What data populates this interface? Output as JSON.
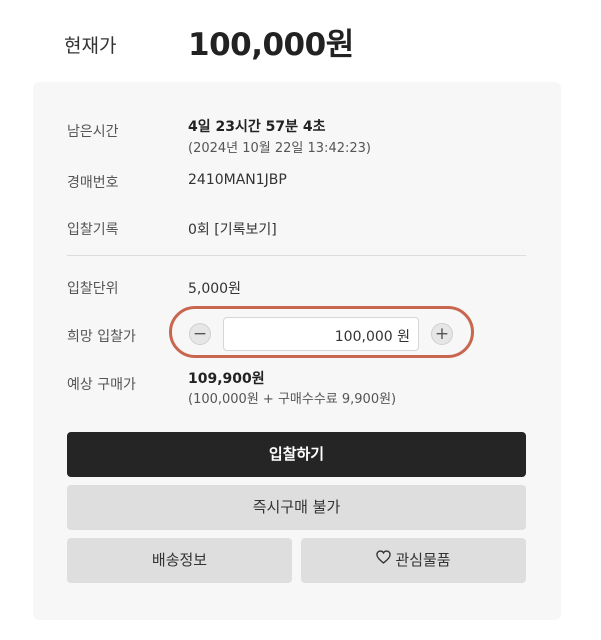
{
  "price": {
    "label": "현재가",
    "value": "100,000원"
  },
  "info": {
    "remaining_label": "남은시간",
    "remaining_value": "4일 23시간 57분 4초",
    "remaining_date": "(2024년 10월 22일 13:42:23)",
    "auction_no_label": "경매번호",
    "auction_no_value": "2410MAN1JBP",
    "bid_history_label": "입찰기록",
    "bid_history_count": "0회",
    "bid_history_link": "[기록보기]"
  },
  "bidding": {
    "unit_label": "입찰단위",
    "unit_value": "5,000원",
    "desired_label": "희망 입찰가",
    "decrement_symbol": "−",
    "increment_symbol": "+",
    "bid_amount": "100,000 원",
    "expected_label": "예상 구매가",
    "expected_value": "109,900원",
    "expected_breakdown": "(100,000원 + 구매수수료 9,900원)"
  },
  "actions": {
    "bid_button": "입찰하기",
    "instant_buy_button": "즉시구매 불가",
    "shipping_button": "배송정보",
    "wishlist_button": "관심물품",
    "wishlist_icon": "heart-outline-icon"
  },
  "colors": {
    "primary_button": "#252525",
    "highlight_outline": "#c9664f",
    "card_background": "#f7f7f7"
  }
}
